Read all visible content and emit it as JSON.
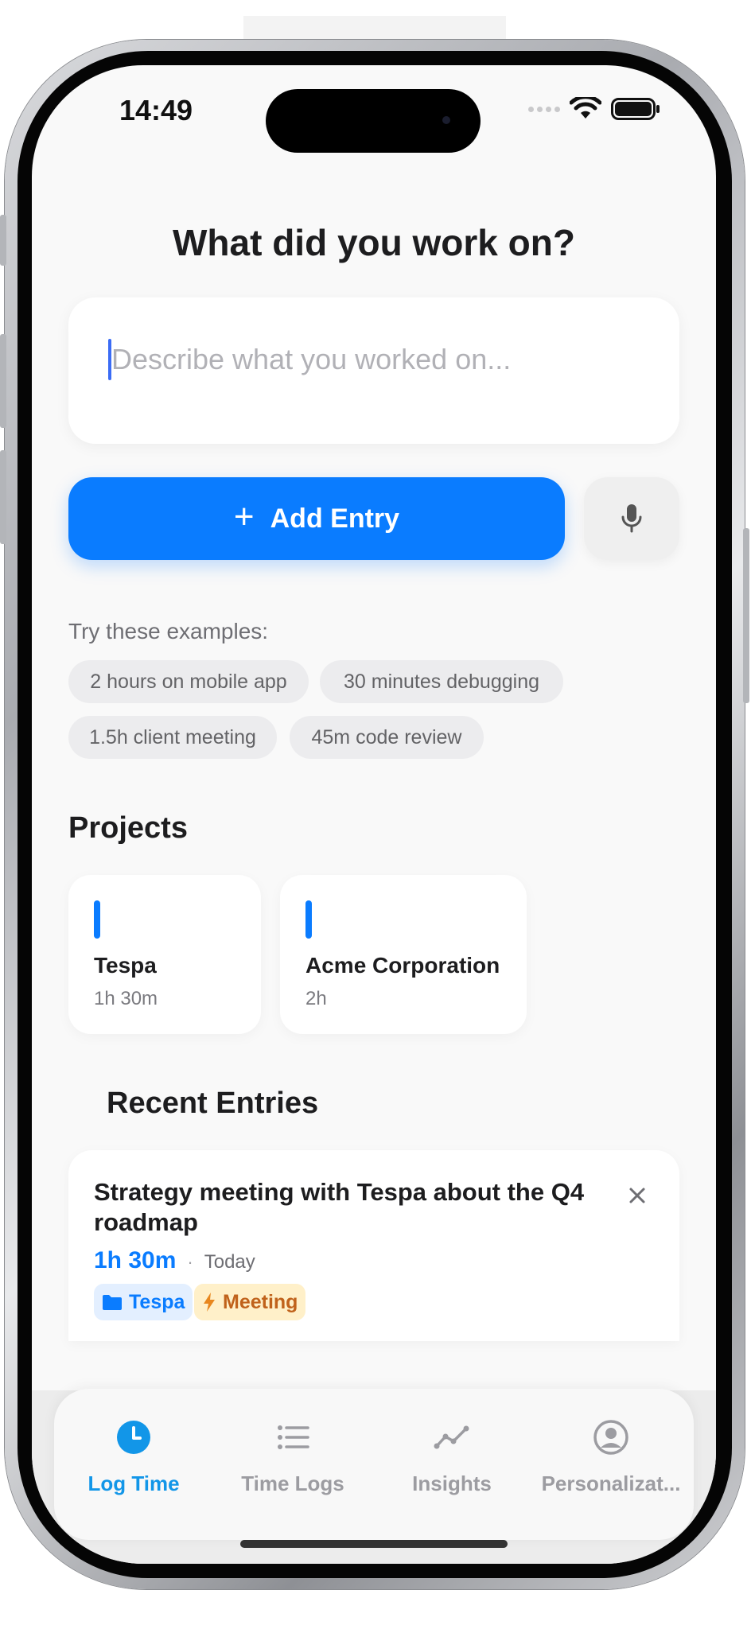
{
  "status_bar": {
    "time": "14:49"
  },
  "header": {
    "title": "What did you work on?"
  },
  "entry_input": {
    "placeholder": "Describe what you worked on..."
  },
  "actions": {
    "add_label": "Add Entry"
  },
  "examples": {
    "label": "Try these examples:",
    "chips": [
      "2 hours on mobile app",
      "30 minutes debugging",
      "1.5h client meeting",
      "45m code review"
    ]
  },
  "projects": {
    "title": "Projects",
    "items": [
      {
        "name": "Tespa",
        "time": "1h 30m"
      },
      {
        "name": "Acme Corporation",
        "time": "2h"
      }
    ]
  },
  "recent": {
    "title": "Recent Entries",
    "entries": [
      {
        "title": "Strategy meeting with Tespa about the Q4 roadmap",
        "duration": "1h 30m",
        "date": "Today",
        "project_tag": "Tespa",
        "type_tag": "Meeting"
      }
    ]
  },
  "tabs": [
    {
      "label": "Log Time",
      "icon": "clock-icon",
      "active": true
    },
    {
      "label": "Time Logs",
      "icon": "list-icon",
      "active": false
    },
    {
      "label": "Insights",
      "icon": "trend-icon",
      "active": false
    },
    {
      "label": "Personalizat...",
      "icon": "person-icon",
      "active": false
    }
  ],
  "colors": {
    "accent": "#0a7cff",
    "tab_active": "#1296e8",
    "meeting_tag_bg": "#fff0c9",
    "meeting_tag_text": "#c0621b"
  }
}
